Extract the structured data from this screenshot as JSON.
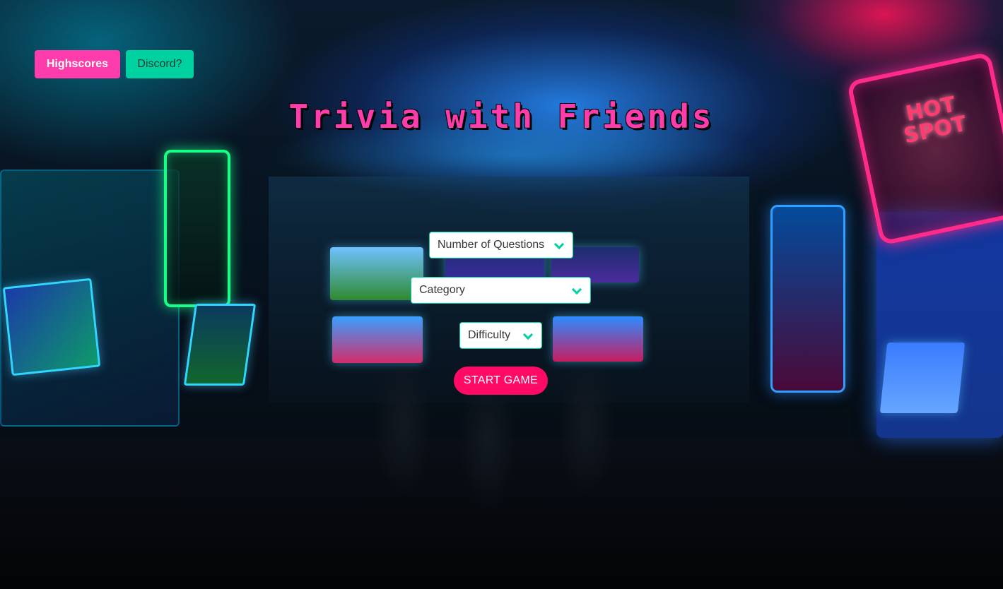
{
  "nav": {
    "highscores_label": "Highscores",
    "discord_label": "Discord?"
  },
  "title": "Trivia with Friends",
  "form": {
    "questions_select": "Number of Questions",
    "category_select": "Category",
    "difficulty_select": "Difficulty",
    "start_label": "START GAME"
  },
  "background": {
    "sign_text": "HOT SPOT"
  },
  "colors": {
    "pink": "#ff3cac",
    "teal": "#00d1a0",
    "start": "#ff0a64"
  }
}
